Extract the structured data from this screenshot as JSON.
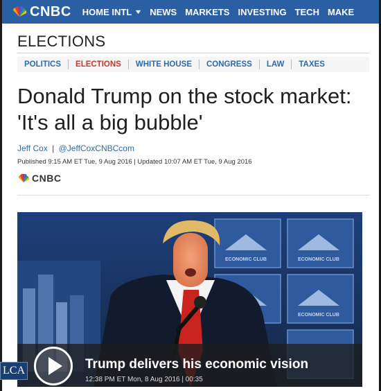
{
  "brand": {
    "name": "CNBC",
    "colors": {
      "nav_bg": "#2a5fa3",
      "link": "#2f6aa8",
      "active": "#c0392b"
    }
  },
  "topnav": {
    "items": [
      "HOME INTL",
      "NEWS",
      "MARKETS",
      "INVESTING",
      "TECH",
      "MAKE"
    ]
  },
  "section": {
    "title": "ELECTIONS",
    "subnav": [
      "POLITICS",
      "ELECTIONS",
      "WHITE HOUSE",
      "CONGRESS",
      "LAW",
      "TAXES"
    ],
    "active_index": 1
  },
  "article": {
    "headline": "Donald Trump on the stock market: 'It's all a big bubble'",
    "author": "Jeff Cox",
    "handle": "@JeffCoxCNBCcom",
    "byline_sep": "|",
    "dateline": "Published 9:15 AM ET Tue, 9 Aug 2016 | Updated 10:07 AM ET Tue, 9 Aug 2016",
    "source_logo": "CNBC"
  },
  "video": {
    "title": "Trump delivers his economic vision",
    "meta": "12:38 PM ET Mon, 8 Aug 2016 | 00:35",
    "play_icon": "play-icon",
    "backdrop_text": "ECONOMIC CLUB"
  },
  "watermark": {
    "text": "LCA"
  }
}
